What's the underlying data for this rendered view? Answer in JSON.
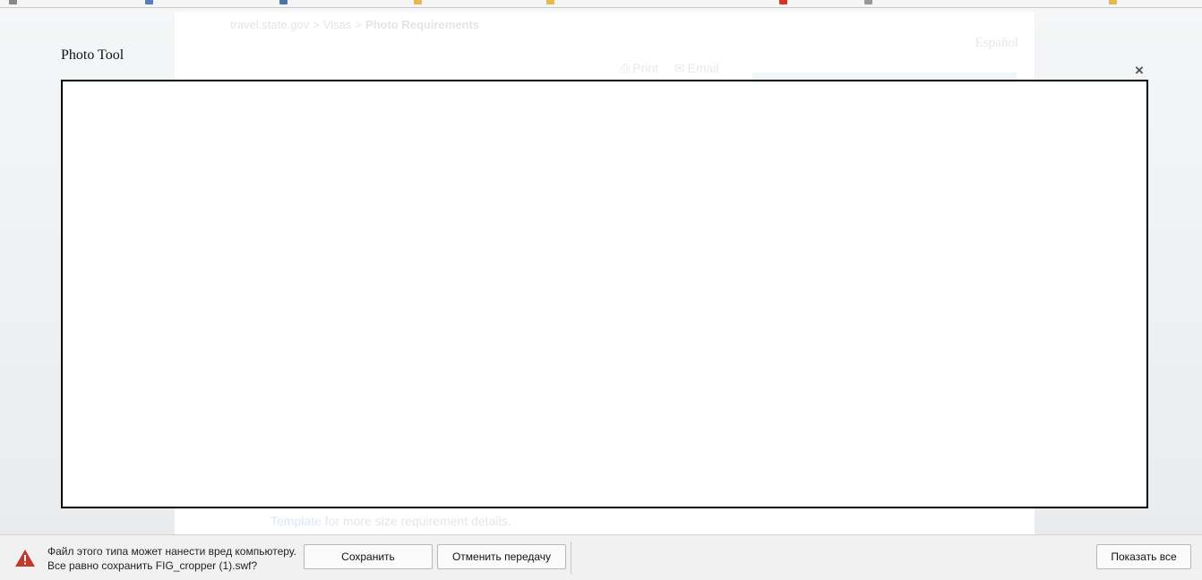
{
  "background_page": {
    "breadcrumb": [
      "travel.state.gov",
      "Visas",
      "Photo Requirements"
    ],
    "breadcrumb_separator": ">",
    "language_link": "Español",
    "tools": {
      "print_label": "Print",
      "email_label": "Email"
    },
    "footer_text": {
      "link": "Template",
      "rest": " for more size requirement details."
    }
  },
  "dialog": {
    "title": "Photo Tool",
    "close_symbol": "×"
  },
  "download_bar": {
    "warning_line1": "Файл этого типа может нанести вред компьютеру.",
    "warning_line2": "Все равно сохранить FIG_cropper (1).swf?",
    "save_label": "Сохранить",
    "cancel_label": "Отменить передачу",
    "show_all_label": "Показать все",
    "warning_color": "#c0392b"
  },
  "icons": {
    "print": "printer-icon",
    "email": "envelope-icon",
    "warning": "warning-triangle-icon",
    "close": "close-icon"
  }
}
